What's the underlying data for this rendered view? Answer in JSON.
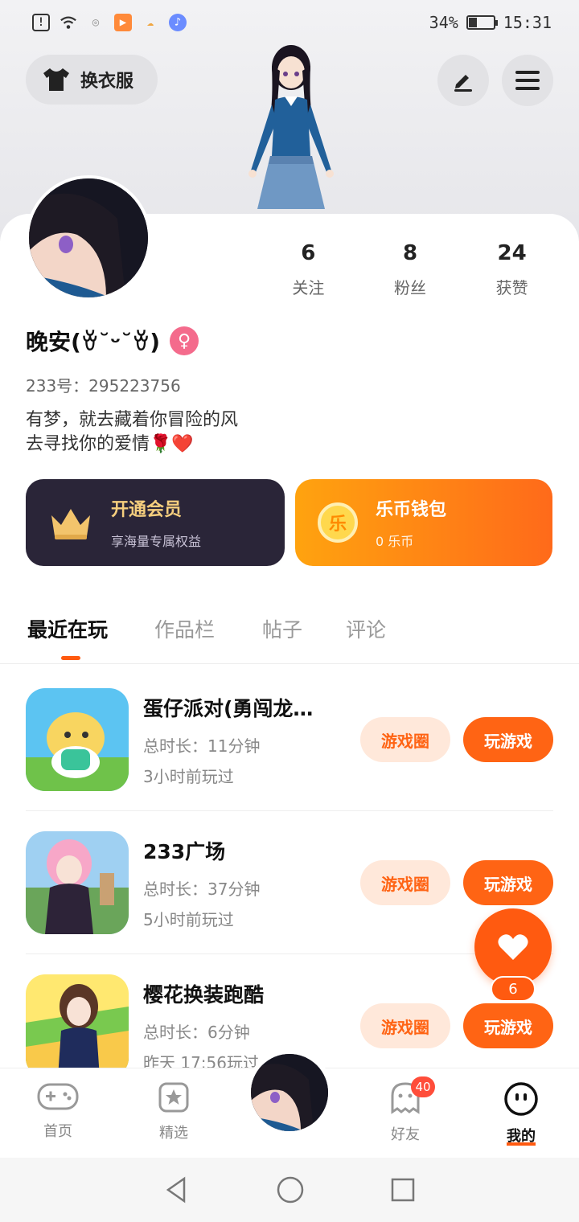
{
  "status_bar": {
    "battery": "34%",
    "battery_level": 0.34,
    "time": "15:31"
  },
  "header": {
    "outfit_label": "换衣服"
  },
  "profile": {
    "stats": [
      {
        "num": "6",
        "label": "关注"
      },
      {
        "num": "8",
        "label": "粉丝"
      },
      {
        "num": "24",
        "label": "获赞"
      }
    ],
    "nickname": "晚安(ꈊ˘ᵕ˘ꈊ)",
    "user_id": "233号：295223756",
    "bio": "有梦，就去藏着你冒险的风\n去寻找你的爱情🌹❤️"
  },
  "promos": {
    "vip": {
      "title": "开通会员",
      "subtitle": "享海量专属权益"
    },
    "wallet": {
      "title": "乐币钱包",
      "subtitle": "0 乐币",
      "coin_label": "乐"
    }
  },
  "tabs": [
    "最近在玩",
    "作品栏",
    "帖子",
    "评论"
  ],
  "games": [
    {
      "name": "蛋仔派对(勇闯龙…",
      "duration": "总时长：11分钟",
      "last_played": "3小时前玩过",
      "circle_label": "游戏圈",
      "play_label": "玩游戏"
    },
    {
      "name": "233广场",
      "duration": "总时长：37分钟",
      "last_played": "5小时前玩过",
      "circle_label": "游戏圈",
      "play_label": "玩游戏"
    },
    {
      "name": "樱花换装跑酷",
      "duration": "总时长：6分钟",
      "last_played": "昨天 17:56玩过",
      "circle_label": "游戏圈",
      "play_label": "玩游戏"
    }
  ],
  "like_fab": {
    "count": "6"
  },
  "bottom_nav": {
    "items": [
      {
        "label": "首页"
      },
      {
        "label": "精选"
      },
      {
        "label": "好友",
        "badge": "40"
      },
      {
        "label": "我的"
      }
    ]
  },
  "colors": {
    "accent": "#ff5a10",
    "vip_bg": "#2a2538",
    "gold": "#f6cf7e"
  }
}
